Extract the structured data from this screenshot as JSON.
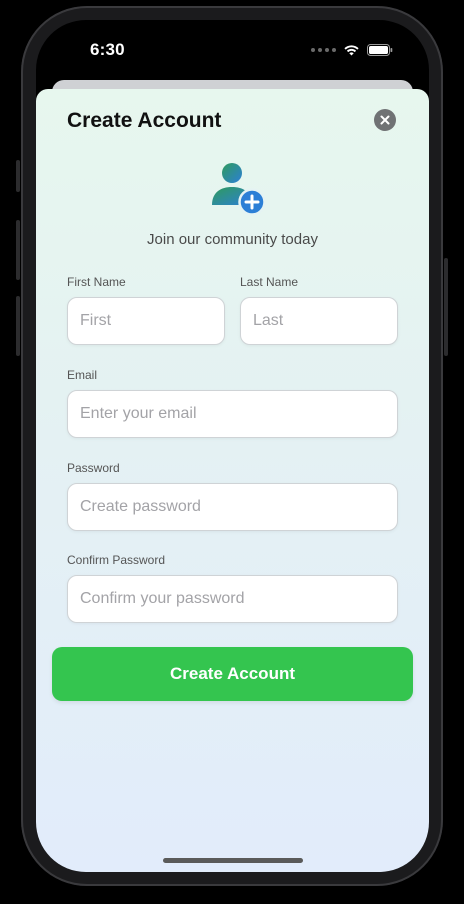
{
  "status_bar": {
    "time": "6:30"
  },
  "sheet": {
    "title": "Create Account",
    "tagline": "Join our community today"
  },
  "form": {
    "first_name": {
      "label": "First Name",
      "placeholder": "First",
      "value": ""
    },
    "last_name": {
      "label": "Last Name",
      "placeholder": "Last",
      "value": ""
    },
    "email": {
      "label": "Email",
      "placeholder": "Enter your email",
      "value": ""
    },
    "password": {
      "label": "Password",
      "placeholder": "Create password",
      "value": ""
    },
    "confirm_password": {
      "label": "Confirm Password",
      "placeholder": "Confirm your password",
      "value": ""
    },
    "submit_label": "Create Account"
  },
  "colors": {
    "accent": "#34c54f",
    "icon_gradient_start": "#2f9b5c",
    "icon_gradient_end": "#2c7fd6",
    "plus_badge": "#2c7fd6"
  },
  "icons": {
    "close": "xmark-circle-icon",
    "hero": "person-add-icon",
    "wifi": "wifi-icon",
    "battery": "battery-icon"
  }
}
